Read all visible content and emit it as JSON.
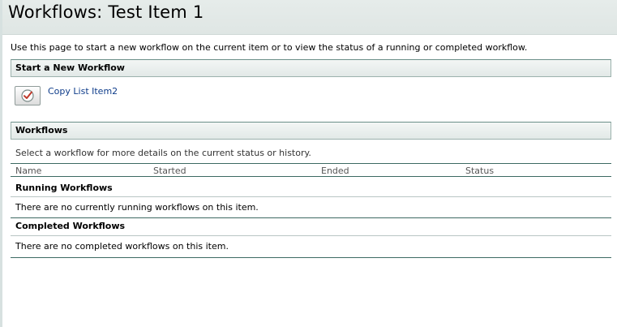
{
  "page": {
    "title": "Workflows: Test Item 1",
    "intro": "Use this page to start a new workflow on the current item or to view the status of a running or completed workflow."
  },
  "start_section": {
    "header": "Start a New Workflow",
    "workflow_icon": "workflow-checkmark-icon",
    "workflow_name": "Copy List Item2"
  },
  "workflows_section": {
    "header": "Workflows",
    "instructions": "Select a workflow for more details on the current status or history.",
    "columns": {
      "name": "Name",
      "started": "Started",
      "ended": "Ended",
      "status": "Status"
    },
    "running": {
      "title": "Running Workflows",
      "empty_message": "There are no currently running workflows on this item."
    },
    "completed": {
      "title": "Completed Workflows",
      "empty_message": "There are no completed workflows on this item."
    }
  },
  "colors": {
    "link": "#0e3c8a",
    "rule": "#3d6a63",
    "header_bg": "#e2e9e7",
    "icon_check": "#c0392b"
  }
}
